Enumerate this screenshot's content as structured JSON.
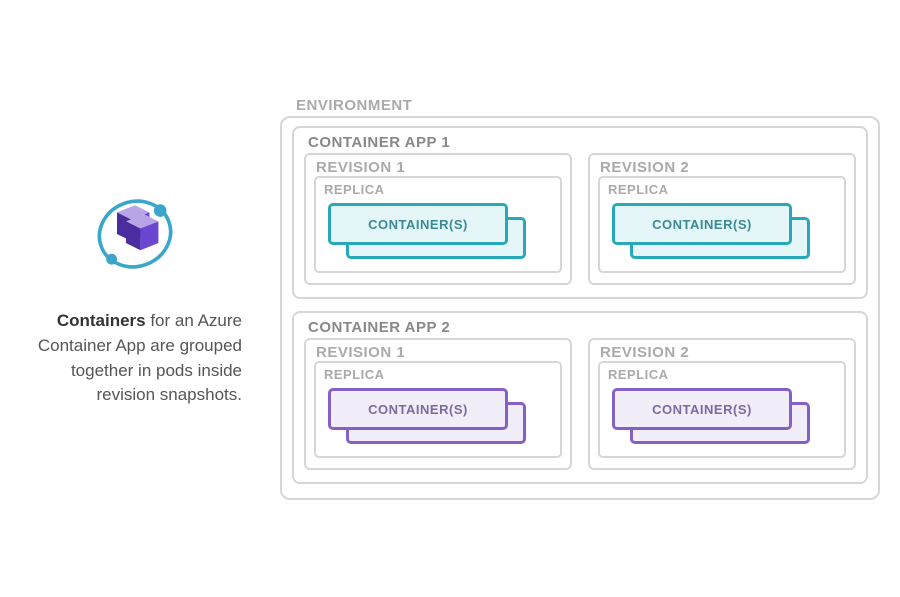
{
  "description": {
    "bold": "Containers",
    "rest": " for an Azure Container App are grouped together in pods inside revision snapshots."
  },
  "environment": {
    "label": "ENVIRONMENT",
    "apps": [
      {
        "title": "CONTAINER APP 1",
        "theme": "teal",
        "revisions": [
          {
            "title": "REVISION 1",
            "replica_label": "REPLICA",
            "container_label": "CONTAINER(S)"
          },
          {
            "title": "REVISION 2",
            "replica_label": "REPLICA",
            "container_label": "CONTAINER(S)"
          }
        ]
      },
      {
        "title": "CONTAINER APP 2",
        "theme": "purple",
        "revisions": [
          {
            "title": "REVISION 1",
            "replica_label": "REPLICA",
            "container_label": "CONTAINER(S)"
          },
          {
            "title": "REVISION 2",
            "replica_label": "REPLICA",
            "container_label": "CONTAINER(S)"
          }
        ]
      }
    ]
  },
  "colors": {
    "teal": "#28a8b8",
    "purple": "#8661c5",
    "border_gray": "#d6d6d6",
    "text_gray": "#aaa"
  }
}
